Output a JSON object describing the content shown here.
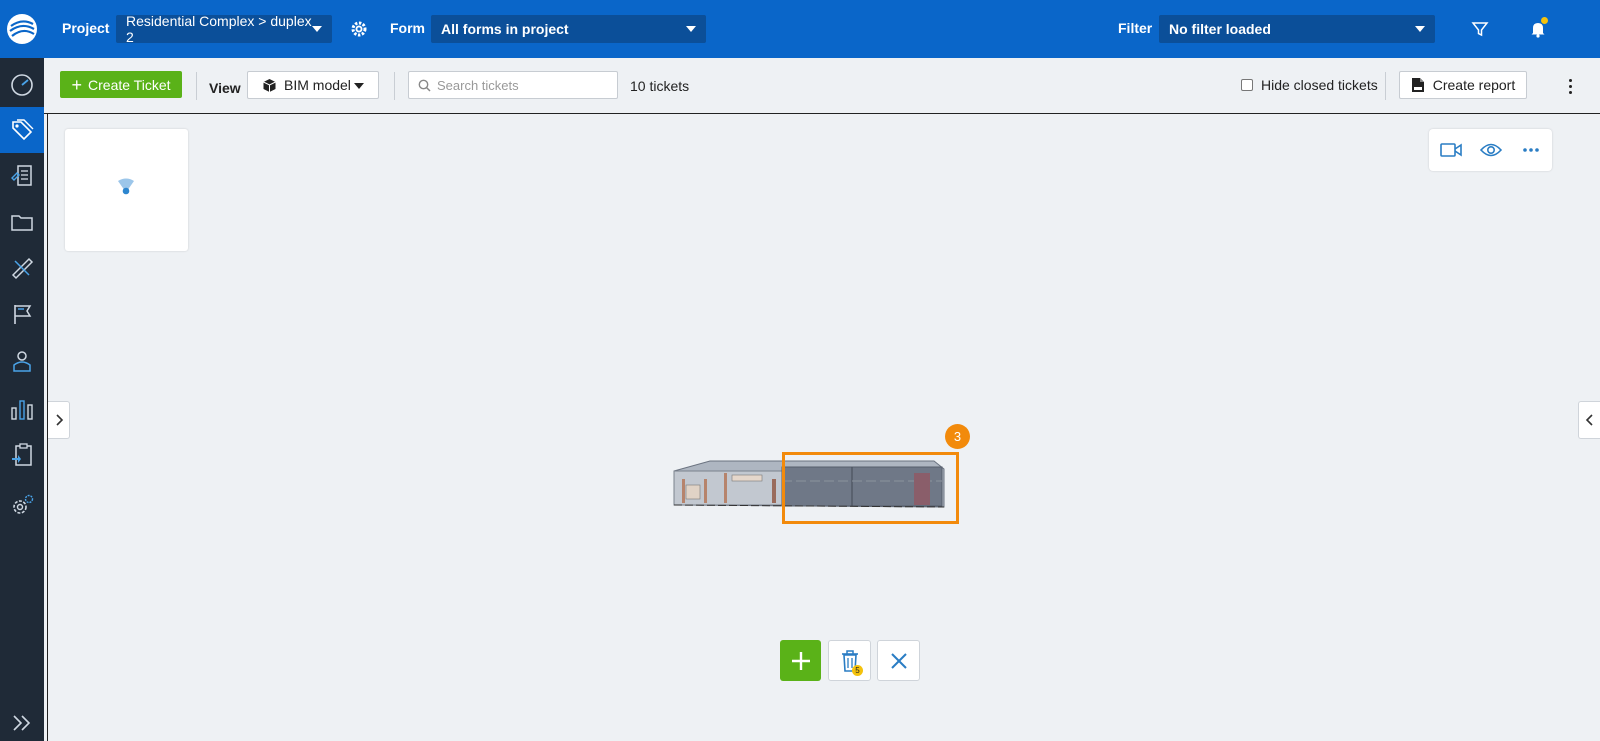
{
  "topbar": {
    "project_label": "Project",
    "project_value": "Residential Complex > duplex 2",
    "form_label": "Form",
    "form_value": "All forms in project",
    "filter_label": "Filter",
    "filter_value": "No filter loaded"
  },
  "toolbar": {
    "create_ticket_label": "Create Ticket",
    "view_label": "View",
    "view_value": "BIM model",
    "search_placeholder": "Search tickets",
    "search_value": "",
    "ticket_count": "10 tickets",
    "hide_closed_label": "Hide closed tickets",
    "hide_closed_checked": false,
    "create_report_label": "Create report"
  },
  "viewer": {
    "selection_badge": "3",
    "delete_count": "5"
  },
  "colors": {
    "brand_blue": "#0a66c9",
    "sidebar_dark": "#1f2a37",
    "accent_green": "#5ab218",
    "selection_orange": "#f28a0b",
    "notification_yellow": "#f4c20d"
  },
  "sidebar": {
    "items": [
      {
        "icon": "dashboard-gauge-icon"
      },
      {
        "icon": "tickets-tag-icon",
        "active": true
      },
      {
        "icon": "forms-document-icon"
      },
      {
        "icon": "folder-icon"
      },
      {
        "icon": "ruler-measure-icon"
      },
      {
        "icon": "flag-icon"
      },
      {
        "icon": "user-contact-icon"
      },
      {
        "icon": "bar-chart-icon"
      },
      {
        "icon": "clipboard-icon"
      },
      {
        "icon": "settings-gear-icon"
      },
      {
        "icon": "expand-chevrons-icon"
      }
    ]
  }
}
